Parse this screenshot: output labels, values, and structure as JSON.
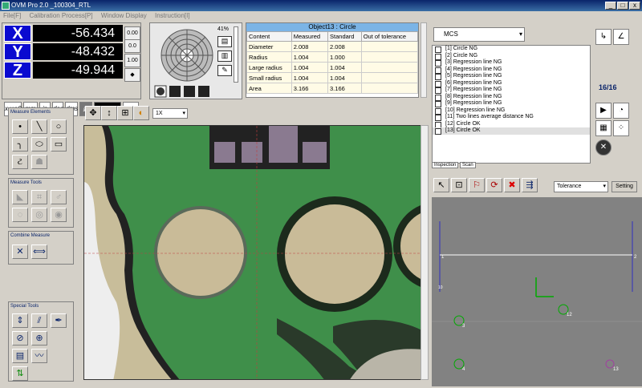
{
  "window": {
    "title": "OVM Pro 2.0  _100304_RTL"
  },
  "menu": [
    "File[F]",
    "Calibration Process[P]",
    "Window Display",
    "Instruction[I]"
  ],
  "dro": {
    "axes": [
      {
        "label": "X",
        "value": "-56.434"
      },
      {
        "label": "Y",
        "value": "-48.432"
      },
      {
        "label": "Z",
        "value": "-49.944"
      }
    ],
    "side_buttons": [
      "0.00",
      "0.0",
      "1.00"
    ],
    "bottom_buttons": [
      "x,y,r,θ",
      "mm",
      "in",
      "deg",
      "dms"
    ],
    "readout": "0/4:0/2",
    "readout2": "3"
  },
  "light": {
    "percent": "41%"
  },
  "result": {
    "title": "Object13 : Circle",
    "headers": [
      "Content",
      "Measured",
      "Standard",
      "Out of tolerance"
    ],
    "rows": [
      [
        "Diameter",
        "2.008",
        "2.008",
        ""
      ],
      [
        "Radius",
        "1.004",
        "1.000",
        ""
      ],
      [
        "Large radius",
        "1.004",
        "1.004",
        ""
      ],
      [
        "Small radius",
        "1.004",
        "1.004",
        ""
      ],
      [
        "Area",
        "3.166",
        "3.166",
        ""
      ]
    ]
  },
  "objects": {
    "coordinate_system": "MCS",
    "count": "16/16",
    "items": [
      "[1] Circle  NG",
      "[2] Circle  NG",
      "[3] Regression line  NG",
      "[4] Regression line  NG",
      "[5] Regression line  NG",
      "[6] Regression line  NG",
      "[7] Regression line  NG",
      "[8] Regression line  NG",
      "[9] Regression line  NG",
      "[10] Regression line  NG",
      "[11] Two lines average distance  NG",
      "[12] Circle  OK",
      "[13] Circle  OK"
    ],
    "tabs": [
      "Inspection",
      "Scan"
    ]
  },
  "left": {
    "measure_elements": "Measure Elements",
    "measure_tools": "Measure Tools",
    "combine_measure": "Combine Measure",
    "special_tools": "Special Tools"
  },
  "camera": {
    "zoom": "1X"
  },
  "plot": {
    "tolerance": "Tolerance",
    "setting": "Setting",
    "labels": [
      "3",
      "4",
      "12",
      "13",
      "1",
      "2",
      "10"
    ]
  },
  "colors": {
    "accent": "#0a246a",
    "dro_label": "#0a0ad0",
    "board": "#3f8f4a"
  }
}
